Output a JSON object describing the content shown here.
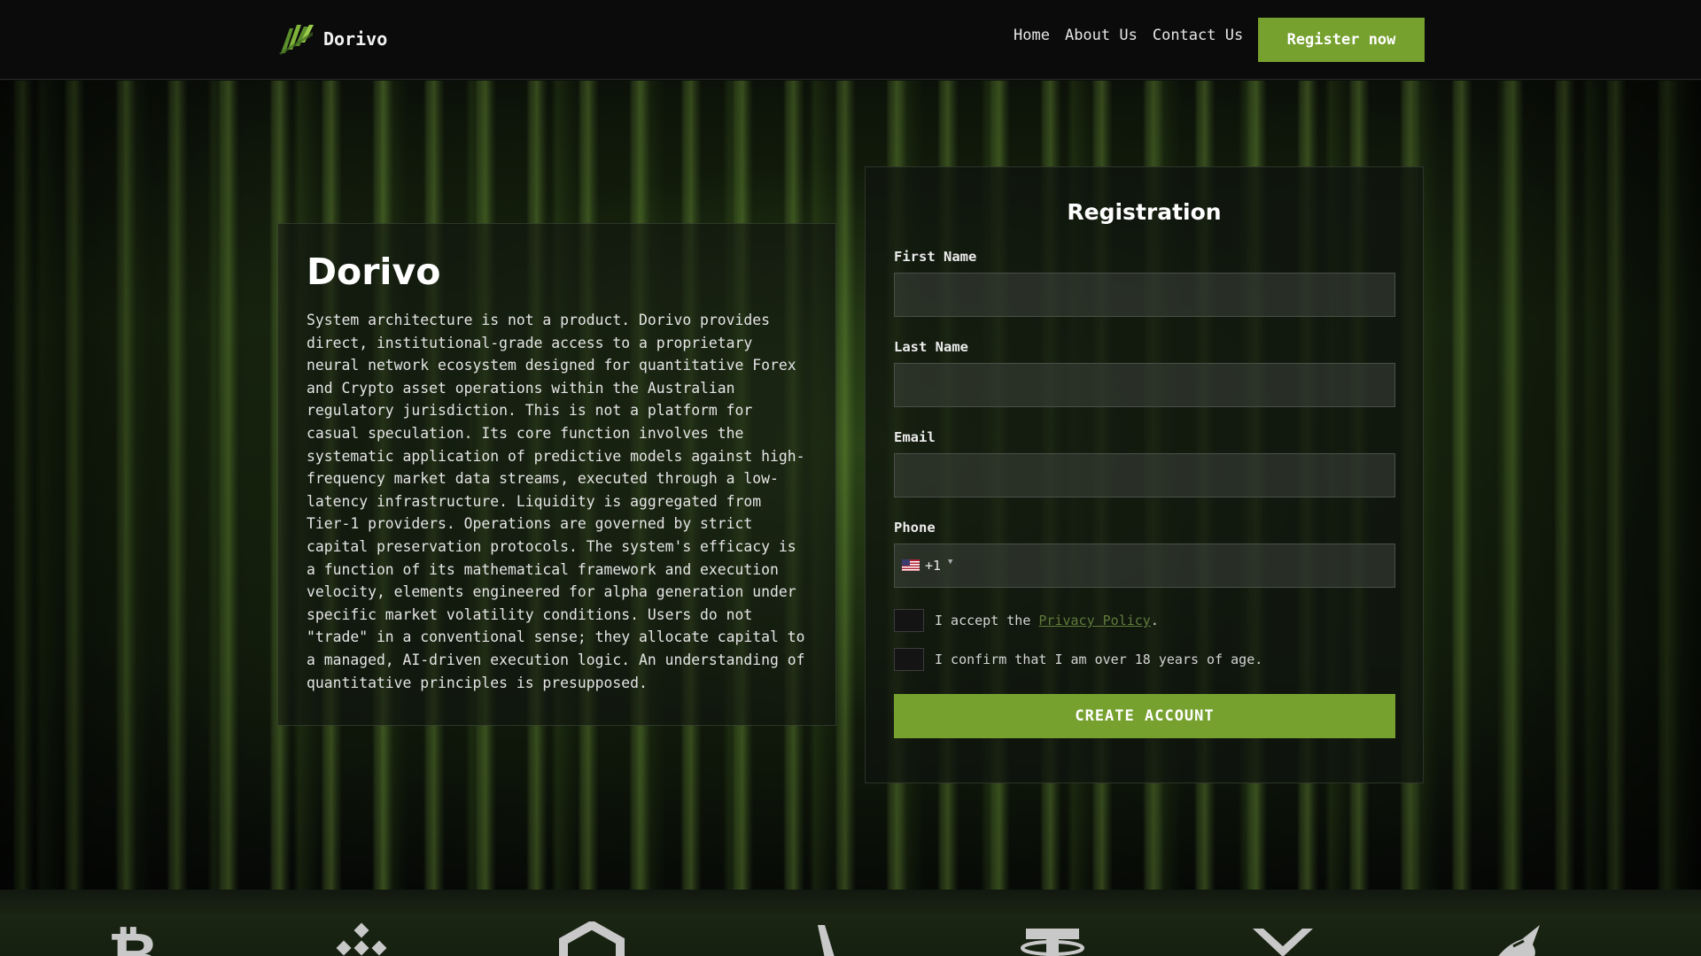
{
  "header": {
    "brand": "Dorivo",
    "nav": [
      "Home",
      "About Us",
      "Contact Us"
    ],
    "cta": "Register now"
  },
  "info": {
    "title": "Dorivo",
    "body": "System architecture is not a product. Dorivo provides direct, institutional-grade access to a proprietary neural network ecosystem designed for quantitative Forex and Crypto asset operations within the Australian regulatory jurisdiction. This is not a platform for casual speculation. Its core function involves the systematic application of predictive models against high-frequency market data streams, executed through a low-latency infrastructure. Liquidity is aggregated from Tier-1 providers. Operations are governed by strict capital preservation protocols. The system's efficacy is a function of its mathematical framework and execution velocity, elements engineered for alpha generation under specific market volatility conditions. Users do not \"trade\" in a conventional sense; they allocate capital to a managed, AI-driven execution logic. An understanding of quantitative principles is presupposed."
  },
  "form": {
    "title": "Registration",
    "first_name_label": "First Name",
    "last_name_label": "Last Name",
    "email_label": "Email",
    "phone_label": "Phone",
    "phone_dial": "+1",
    "privacy_prefix": "I accept the ",
    "privacy_link": "Privacy Policy",
    "privacy_suffix": ".",
    "age_confirm": "I confirm that I am over 18 years of age.",
    "submit": "CREATE ACCOUNT"
  },
  "crypto_icons": [
    "bitcoin-icon",
    "binance-icon",
    "chainlink-icon",
    "avalanche-icon",
    "tether-icon",
    "xrp-icon",
    "unicorn-icon"
  ],
  "colors": {
    "accent": "#77a12f",
    "background": "#0b0c0b",
    "link": "#5f7a3a"
  }
}
